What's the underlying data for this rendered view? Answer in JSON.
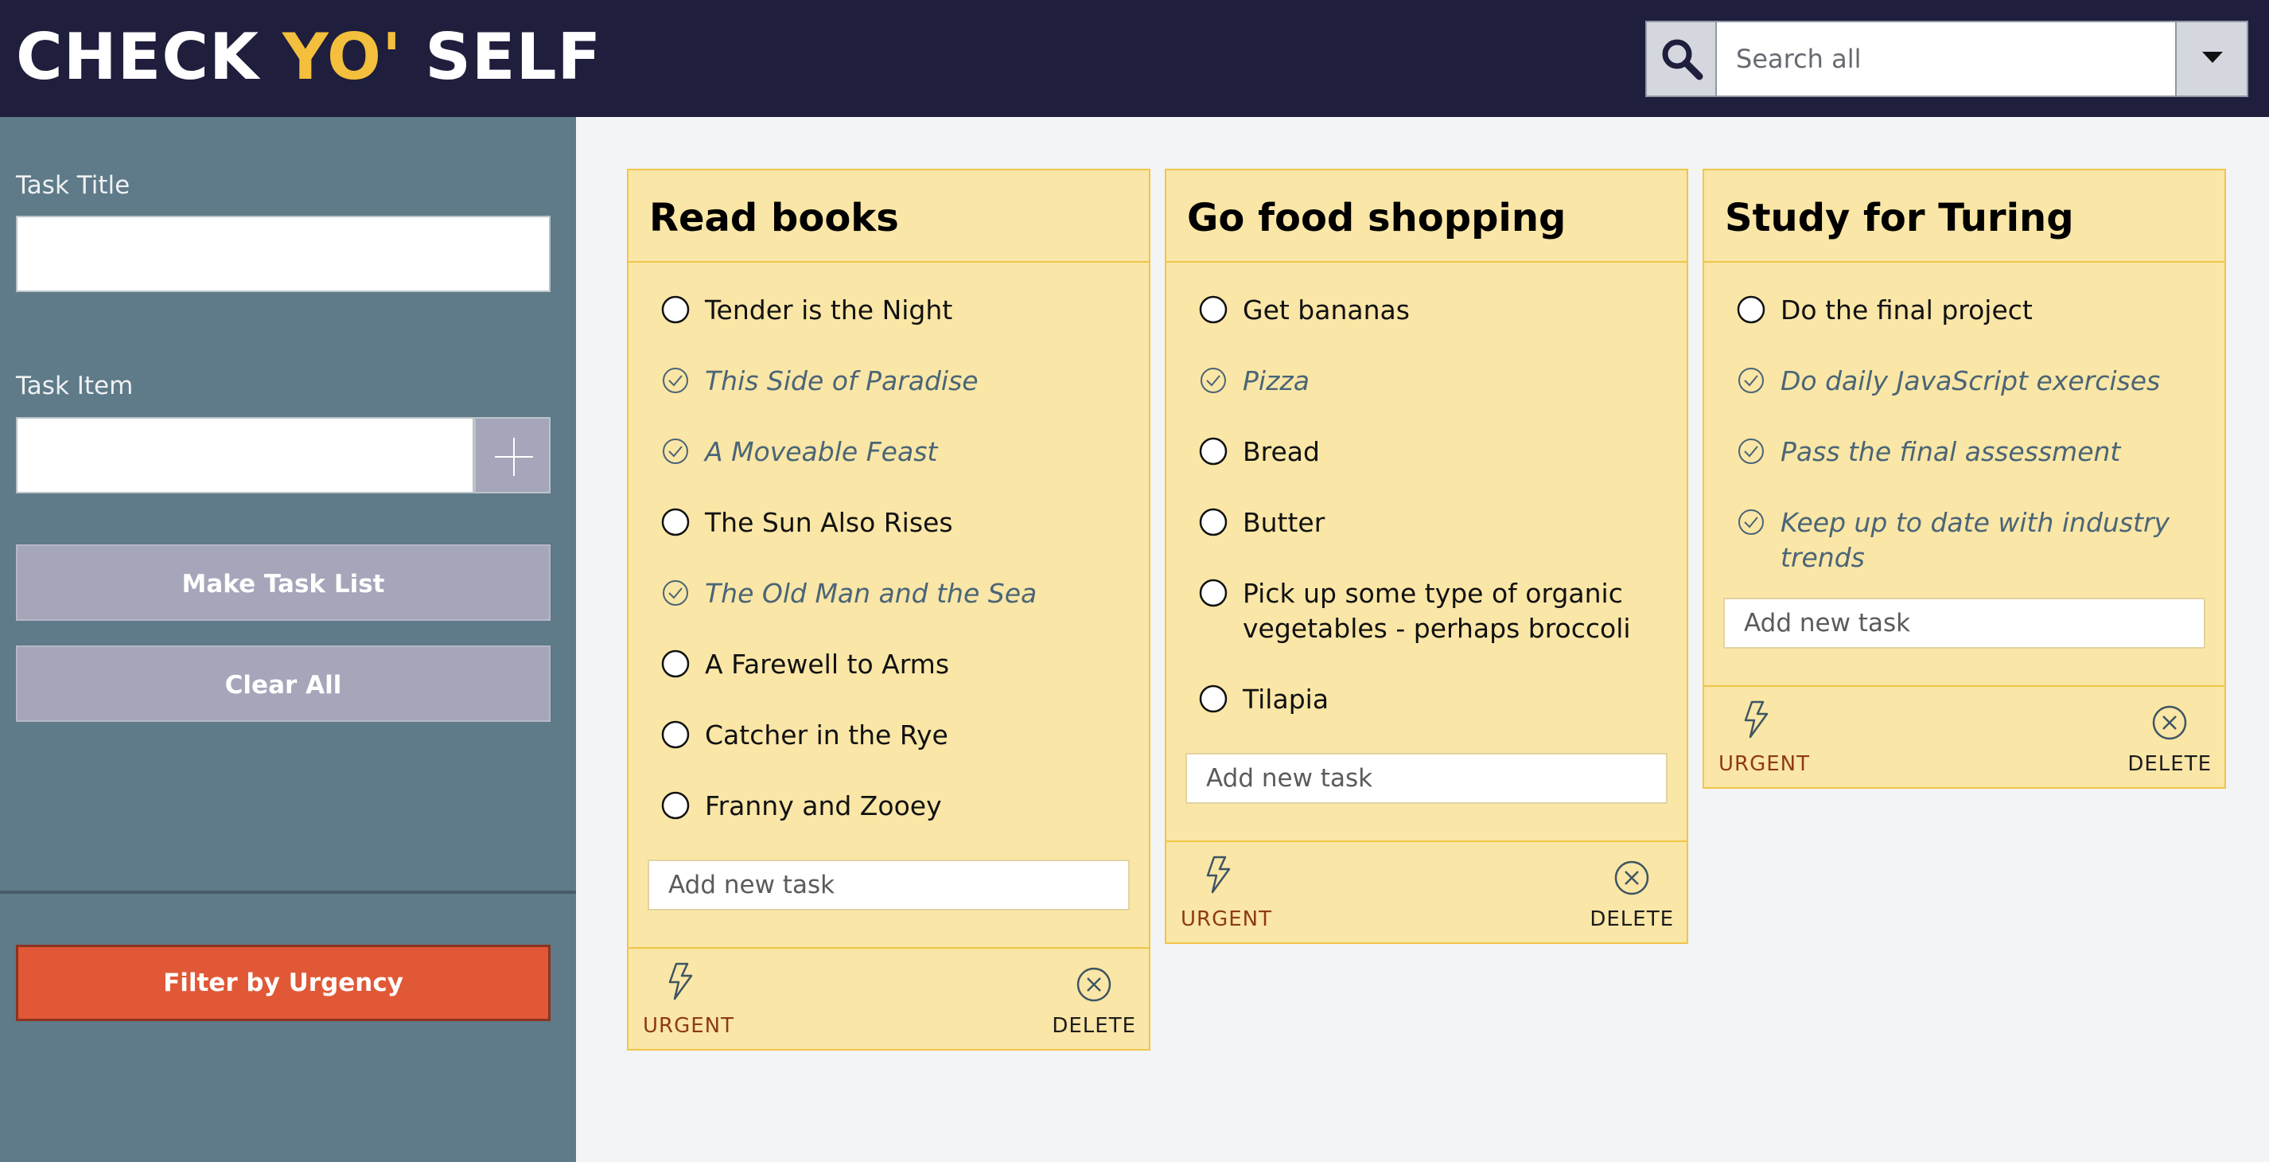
{
  "header": {
    "logo_part1": "CHECK ",
    "logo_accent": "YO'",
    "logo_part2": " SELF",
    "search_placeholder": "Search all"
  },
  "sidebar": {
    "task_title_label": "Task Title",
    "task_item_label": "Task Item",
    "make_task_list": "Make Task List",
    "clear_all": "Clear All",
    "filter_by_urgency": "Filter by Urgency"
  },
  "cards": [
    {
      "title": "Read books",
      "items": [
        {
          "text": "Tender is the Night",
          "done": false
        },
        {
          "text": "This Side of Paradise",
          "done": true
        },
        {
          "text": "A Moveable Feast",
          "done": true
        },
        {
          "text": "The Sun Also Rises",
          "done": false
        },
        {
          "text": "The Old Man and the Sea",
          "done": true
        },
        {
          "text": "A Farewell to Arms",
          "done": false
        },
        {
          "text": "Catcher in the Rye",
          "done": false
        },
        {
          "text": "Franny and Zooey",
          "done": false
        }
      ],
      "add_placeholder": "Add new task",
      "urgent_label": "URGENT",
      "delete_label": "DELETE"
    },
    {
      "title": "Go food shopping",
      "items": [
        {
          "text": "Get bananas",
          "done": false
        },
        {
          "text": "Pizza",
          "done": true
        },
        {
          "text": "Bread",
          "done": false
        },
        {
          "text": "Butter",
          "done": false
        },
        {
          "text": "Pick up some type of organic vegetables - perhaps broccoli",
          "done": false
        },
        {
          "text": "Tilapia",
          "done": false
        }
      ],
      "add_placeholder": "Add new task",
      "urgent_label": "URGENT",
      "delete_label": "DELETE"
    },
    {
      "title": "Study for Turing",
      "items": [
        {
          "text": "Do the final project",
          "done": false
        },
        {
          "text": "Do daily JavaScript exercises",
          "done": true
        },
        {
          "text": "Pass the final assessment",
          "done": true
        },
        {
          "text": "Keep up to date with industry trends",
          "done": true
        }
      ],
      "add_placeholder": "Add new task",
      "urgent_label": "URGENT",
      "delete_label": "DELETE"
    }
  ],
  "colors": {
    "header_bg": "#1f1e3d",
    "logo_accent": "#f3bf3c",
    "sidebar_bg": "#5f7a88",
    "card_bg": "#fae6a6",
    "filter_btn": "#e05836",
    "urgent_text": "#8e3a17"
  },
  "icons": {
    "search": "magnifier-icon",
    "dropdown": "caret-down-icon",
    "add": "plus-icon",
    "unchecked": "empty-circle-icon",
    "checked": "check-circle-icon",
    "urgent": "lightning-icon",
    "delete": "x-circle-icon"
  }
}
